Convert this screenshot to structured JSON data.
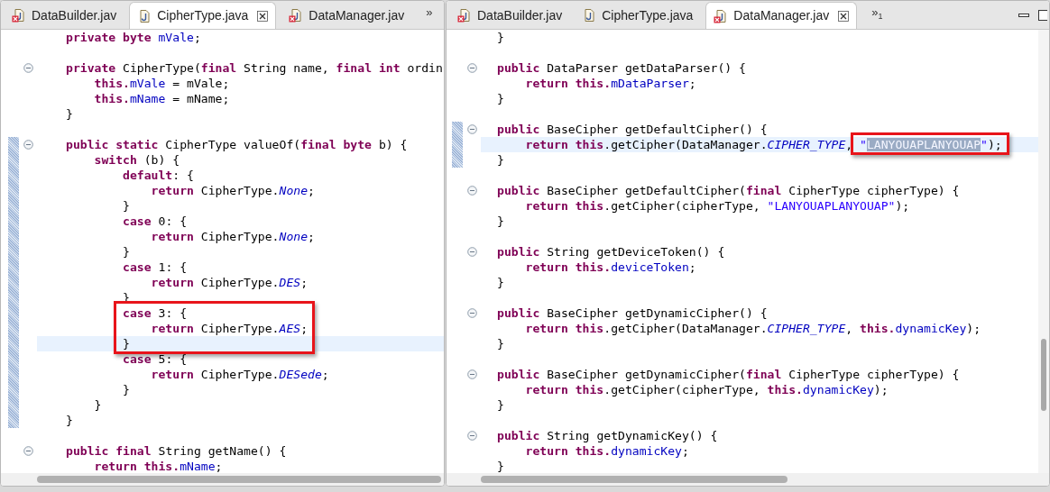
{
  "panes": [
    {
      "tabs": [
        {
          "label": "DataBuilder.jav",
          "error": true,
          "selected": false
        },
        {
          "label": "CipherType.java",
          "error": false,
          "selected": true
        },
        {
          "label": "DataManager.jav",
          "error": true,
          "selected": false
        }
      ],
      "overflow": {
        "chevron": "»"
      },
      "lines": [
        {
          "fold": false,
          "changed": false,
          "current": false,
          "tokens": [
            {
              "kind": "kw",
              "text": "private byte "
            },
            {
              "kind": "field",
              "text": "mVale"
            },
            {
              "kind": "t",
              "text": ";"
            }
          ]
        },
        {
          "fold": false,
          "changed": false,
          "current": false
        },
        {
          "fold": true,
          "changed": false,
          "current": false,
          "tokens": [
            {
              "kind": "kw",
              "text": "private"
            },
            {
              "kind": "t",
              "text": " CipherType("
            },
            {
              "kind": "kw",
              "text": "final"
            },
            {
              "kind": "t",
              "text": " String name, "
            },
            {
              "kind": "kw",
              "text": "final int"
            },
            {
              "kind": "t",
              "text": " ordin"
            }
          ]
        },
        {
          "fold": false,
          "changed": false,
          "current": false,
          "tokens": [
            {
              "kind": "kw",
              "text": "    this."
            },
            {
              "kind": "field",
              "text": "mVale"
            },
            {
              "kind": "t",
              "text": " = mVale;"
            }
          ]
        },
        {
          "fold": false,
          "changed": false,
          "current": false,
          "tokens": [
            {
              "kind": "kw",
              "text": "    this."
            },
            {
              "kind": "field",
              "text": "mName"
            },
            {
              "kind": "t",
              "text": " = mName;"
            }
          ]
        },
        {
          "fold": false,
          "changed": false,
          "current": false,
          "tokens": [
            {
              "kind": "t",
              "text": "}"
            }
          ]
        },
        {
          "fold": false,
          "changed": false,
          "current": false
        },
        {
          "fold": true,
          "changed": true,
          "current": false,
          "tokens": [
            {
              "kind": "kw",
              "text": "public static"
            },
            {
              "kind": "t",
              "text": " CipherType valueOf("
            },
            {
              "kind": "kw",
              "text": "final byte"
            },
            {
              "kind": "t",
              "text": " b) {"
            }
          ]
        },
        {
          "fold": false,
          "changed": true,
          "current": false,
          "tokens": [
            {
              "kind": "kw",
              "text": "    switch"
            },
            {
              "kind": "t",
              "text": " (b) {"
            }
          ]
        },
        {
          "fold": false,
          "changed": true,
          "current": false,
          "tokens": [
            {
              "kind": "kw",
              "text": "        default"
            },
            {
              "kind": "t",
              "text": ": {"
            }
          ]
        },
        {
          "fold": false,
          "changed": true,
          "current": false,
          "tokens": [
            {
              "kind": "kw",
              "text": "            return"
            },
            {
              "kind": "t",
              "text": " CipherType."
            },
            {
              "kind": "const",
              "text": "None"
            },
            {
              "kind": "t",
              "text": ";"
            }
          ]
        },
        {
          "fold": false,
          "changed": true,
          "current": false,
          "tokens": [
            {
              "kind": "t",
              "text": "        }"
            }
          ]
        },
        {
          "fold": false,
          "changed": true,
          "current": false,
          "tokens": [
            {
              "kind": "kw",
              "text": "        case"
            },
            {
              "kind": "t",
              "text": " 0: {"
            }
          ]
        },
        {
          "fold": false,
          "changed": true,
          "current": false,
          "tokens": [
            {
              "kind": "kw",
              "text": "            return"
            },
            {
              "kind": "t",
              "text": " CipherType."
            },
            {
              "kind": "const",
              "text": "None"
            },
            {
              "kind": "t",
              "text": ";"
            }
          ]
        },
        {
          "fold": false,
          "changed": true,
          "current": false,
          "tokens": [
            {
              "kind": "t",
              "text": "        }"
            }
          ]
        },
        {
          "fold": false,
          "changed": true,
          "current": false,
          "tokens": [
            {
              "kind": "kw",
              "text": "        case"
            },
            {
              "kind": "t",
              "text": " 1: {"
            }
          ]
        },
        {
          "fold": false,
          "changed": true,
          "current": false,
          "tokens": [
            {
              "kind": "kw",
              "text": "            return"
            },
            {
              "kind": "t",
              "text": " CipherType."
            },
            {
              "kind": "const",
              "text": "DES"
            },
            {
              "kind": "t",
              "text": ";"
            }
          ]
        },
        {
          "fold": false,
          "changed": true,
          "current": false,
          "tokens": [
            {
              "kind": "t",
              "text": "        }"
            }
          ]
        },
        {
          "fold": false,
          "changed": true,
          "current": false,
          "box": [
            {
              "kind": "kw",
              "text": "        case"
            },
            {
              "kind": "t",
              "text": " 3: {"
            }
          ]
        },
        {
          "fold": false,
          "changed": true,
          "current": false,
          "box": [
            {
              "kind": "kw",
              "text": "            return"
            },
            {
              "kind": "t",
              "text": " CipherType."
            },
            {
              "kind": "const",
              "text": "AES"
            },
            {
              "kind": "t",
              "text": ";"
            }
          ]
        },
        {
          "fold": false,
          "changed": true,
          "current": true,
          "box": [
            {
              "kind": "t",
              "text": "        }"
            }
          ]
        },
        {
          "fold": false,
          "changed": true,
          "current": false,
          "tokens": [
            {
              "kind": "kw",
              "text": "        case"
            },
            {
              "kind": "t",
              "text": " 5: {"
            }
          ]
        },
        {
          "fold": false,
          "changed": true,
          "current": false,
          "tokens": [
            {
              "kind": "kw",
              "text": "            return"
            },
            {
              "kind": "t",
              "text": " CipherType."
            },
            {
              "kind": "const",
              "text": "DESede"
            },
            {
              "kind": "t",
              "text": ";"
            }
          ]
        },
        {
          "fold": false,
          "changed": true,
          "current": false,
          "tokens": [
            {
              "kind": "t",
              "text": "        }"
            }
          ]
        },
        {
          "fold": false,
          "changed": true,
          "current": false,
          "tokens": [
            {
              "kind": "t",
              "text": "    }"
            }
          ]
        },
        {
          "fold": false,
          "changed": true,
          "current": false,
          "tokens": [
            {
              "kind": "t",
              "text": "}"
            }
          ]
        },
        {
          "fold": false,
          "changed": false,
          "current": false
        },
        {
          "fold": true,
          "changed": false,
          "current": false,
          "tokens": [
            {
              "kind": "kw",
              "text": "public final"
            },
            {
              "kind": "t",
              "text": " String getName() {"
            }
          ]
        },
        {
          "fold": false,
          "changed": false,
          "current": false,
          "tokens": [
            {
              "kind": "kw",
              "text": "    return this."
            },
            {
              "kind": "field",
              "text": "mName"
            },
            {
              "kind": "t",
              "text": ";"
            }
          ]
        }
      ]
    },
    {
      "tabs": [
        {
          "label": "DataBuilder.jav",
          "error": true,
          "selected": false
        },
        {
          "label": "CipherType.java",
          "error": false,
          "selected": false
        },
        {
          "label": "DataManager.jav",
          "error": true,
          "selected": true
        }
      ],
      "overflow": {
        "chevron": "»",
        "count": "1"
      },
      "lines": [
        {
          "fold": false,
          "changed": false,
          "current": false,
          "tokens": [
            {
              "kind": "t",
              "text": "}"
            }
          ]
        },
        {
          "fold": false,
          "changed": false,
          "current": false
        },
        {
          "fold": true,
          "changed": false,
          "current": false,
          "tokens": [
            {
              "kind": "kw",
              "text": "public"
            },
            {
              "kind": "t",
              "text": " DataParser getDataParser() {"
            }
          ]
        },
        {
          "fold": false,
          "changed": false,
          "current": false,
          "tokens": [
            {
              "kind": "kw",
              "text": "    return this."
            },
            {
              "kind": "field",
              "text": "mDataParser"
            },
            {
              "kind": "t",
              "text": ";"
            }
          ]
        },
        {
          "fold": false,
          "changed": false,
          "current": false,
          "tokens": [
            {
              "kind": "t",
              "text": "}"
            }
          ]
        },
        {
          "fold": false,
          "changed": false,
          "current": false
        },
        {
          "fold": true,
          "changed": true,
          "current": false,
          "tokens": [
            {
              "kind": "kw",
              "text": "public"
            },
            {
              "kind": "t",
              "text": " BaseCipher getDefaultCipher() {"
            }
          ]
        },
        {
          "fold": false,
          "changed": true,
          "current": true,
          "tokens": [
            {
              "kind": "kw",
              "text": "    return this"
            },
            {
              "kind": "t",
              "text": ".getCipher(DataManager."
            },
            {
              "kind": "const",
              "text": "CIPHER_TYPE"
            },
            {
              "kind": "t",
              "text": ","
            }
          ],
          "box": [
            {
              "kind": "str",
              "text": " \""
            },
            {
              "kind": "sel",
              "text": "LANYOUAPLANYOUAP"
            },
            {
              "kind": "str",
              "text": "\""
            },
            {
              "kind": "t",
              "text": ");"
            }
          ]
        },
        {
          "fold": false,
          "changed": true,
          "current": false,
          "tokens": [
            {
              "kind": "t",
              "text": "}"
            }
          ]
        },
        {
          "fold": false,
          "changed": false,
          "current": false
        },
        {
          "fold": true,
          "changed": false,
          "current": false,
          "tokens": [
            {
              "kind": "kw",
              "text": "public"
            },
            {
              "kind": "t",
              "text": " BaseCipher getDefaultCipher("
            },
            {
              "kind": "kw",
              "text": "final"
            },
            {
              "kind": "t",
              "text": " CipherType cipherType) {"
            }
          ]
        },
        {
          "fold": false,
          "changed": false,
          "current": false,
          "tokens": [
            {
              "kind": "kw",
              "text": "    return this"
            },
            {
              "kind": "t",
              "text": ".getCipher(cipherType, "
            },
            {
              "kind": "str",
              "text": "\"LANYOUAPLANYOUAP\""
            },
            {
              "kind": "t",
              "text": ");"
            }
          ]
        },
        {
          "fold": false,
          "changed": false,
          "current": false,
          "tokens": [
            {
              "kind": "t",
              "text": "}"
            }
          ]
        },
        {
          "fold": false,
          "changed": false,
          "current": false
        },
        {
          "fold": true,
          "changed": false,
          "current": false,
          "tokens": [
            {
              "kind": "kw",
              "text": "public"
            },
            {
              "kind": "t",
              "text": " String getDeviceToken() {"
            }
          ]
        },
        {
          "fold": false,
          "changed": false,
          "current": false,
          "tokens": [
            {
              "kind": "kw",
              "text": "    return this."
            },
            {
              "kind": "field",
              "text": "deviceToken"
            },
            {
              "kind": "t",
              "text": ";"
            }
          ]
        },
        {
          "fold": false,
          "changed": false,
          "current": false,
          "tokens": [
            {
              "kind": "t",
              "text": "}"
            }
          ]
        },
        {
          "fold": false,
          "changed": false,
          "current": false
        },
        {
          "fold": true,
          "changed": false,
          "current": false,
          "tokens": [
            {
              "kind": "kw",
              "text": "public"
            },
            {
              "kind": "t",
              "text": " BaseCipher getDynamicCipher() {"
            }
          ]
        },
        {
          "fold": false,
          "changed": false,
          "current": false,
          "tokens": [
            {
              "kind": "kw",
              "text": "    return this"
            },
            {
              "kind": "t",
              "text": ".getCipher(DataManager."
            },
            {
              "kind": "const",
              "text": "CIPHER_TYPE"
            },
            {
              "kind": "t",
              "text": ", "
            },
            {
              "kind": "kw",
              "text": "this."
            },
            {
              "kind": "field",
              "text": "dynamicKey"
            },
            {
              "kind": "t",
              "text": ");"
            }
          ]
        },
        {
          "fold": false,
          "changed": false,
          "current": false,
          "tokens": [
            {
              "kind": "t",
              "text": "}"
            }
          ]
        },
        {
          "fold": false,
          "changed": false,
          "current": false
        },
        {
          "fold": true,
          "changed": false,
          "current": false,
          "tokens": [
            {
              "kind": "kw",
              "text": "public"
            },
            {
              "kind": "t",
              "text": " BaseCipher getDynamicCipher("
            },
            {
              "kind": "kw",
              "text": "final"
            },
            {
              "kind": "t",
              "text": " CipherType cipherType) {"
            }
          ]
        },
        {
          "fold": false,
          "changed": false,
          "current": false,
          "tokens": [
            {
              "kind": "kw",
              "text": "    return this"
            },
            {
              "kind": "t",
              "text": ".getCipher(cipherType, "
            },
            {
              "kind": "kw",
              "text": "this."
            },
            {
              "kind": "field",
              "text": "dynamicKey"
            },
            {
              "kind": "t",
              "text": ");"
            }
          ]
        },
        {
          "fold": false,
          "changed": false,
          "current": false,
          "tokens": [
            {
              "kind": "t",
              "text": "}"
            }
          ]
        },
        {
          "fold": false,
          "changed": false,
          "current": false
        },
        {
          "fold": true,
          "changed": false,
          "current": false,
          "tokens": [
            {
              "kind": "kw",
              "text": "public"
            },
            {
              "kind": "t",
              "text": " String getDynamicKey() {"
            }
          ]
        },
        {
          "fold": false,
          "changed": false,
          "current": false,
          "tokens": [
            {
              "kind": "kw",
              "text": "    return this."
            },
            {
              "kind": "field",
              "text": "dynamicKey"
            },
            {
              "kind": "t",
              "text": ";"
            }
          ]
        },
        {
          "fold": false,
          "changed": false,
          "current": false,
          "tokens": [
            {
              "kind": "t",
              "text": "}"
            }
          ]
        }
      ]
    }
  ]
}
